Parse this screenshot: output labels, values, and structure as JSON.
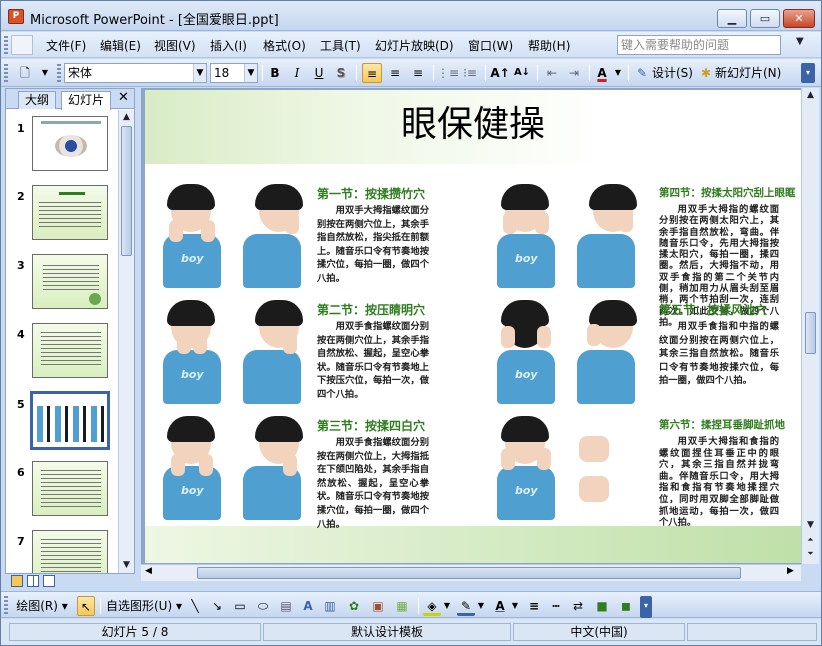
{
  "window": {
    "app_icon": "powerpoint-icon",
    "title": "Microsoft PowerPoint - [全国爱眼日.ppt]"
  },
  "menus": [
    "文件(F)",
    "编辑(E)",
    "视图(V)",
    "插入(I)",
    "格式(O)",
    "工具(T)",
    "幻灯片放映(D)",
    "窗口(W)",
    "帮助(H)"
  ],
  "help_placeholder": "键入需要帮助的问题",
  "formatting": {
    "font_name": "宋体",
    "font_size": "18",
    "bold": "B",
    "italic": "I",
    "underline": "U",
    "shadow": "S",
    "design_label": "设计(S)",
    "new_slide_label": "新幻灯片(N)"
  },
  "pane_tabs": {
    "outline": "大纲",
    "slides": "幻灯片"
  },
  "slide_thumbs": [
    {
      "num": "1",
      "kind": "eye"
    },
    {
      "num": "2",
      "kind": "green-text"
    },
    {
      "num": "3",
      "kind": "green-text"
    },
    {
      "num": "4",
      "kind": "green-text"
    },
    {
      "num": "5",
      "kind": "exercise",
      "selected": true
    },
    {
      "num": "6",
      "kind": "green-text"
    },
    {
      "num": "7",
      "kind": "green-text"
    }
  ],
  "slide": {
    "title": "眼保健操",
    "exercises": [
      {
        "title": "第一节：按揉攒竹穴",
        "desc": "用双手大拇指螺纹面分别按在两侧穴位上，其余手指自然放松，指尖抵在前额上。随音乐口令有节奏地按揉穴位，每拍一圈，做四个八拍。"
      },
      {
        "title": "第二节：按压睛明穴",
        "desc": "用双手食指螺纹面分别按在两侧穴位上，其余手指自然放松、握起，呈空心拳状。随音乐口令有节奏地上下按压穴位，每拍一次，做四个八拍。"
      },
      {
        "title": "第三节：按揉四白穴",
        "desc": "用双手食指螺纹面分别按在两侧穴位上，大拇指抵在下颌凹陷处，其余手指自然放松、握起，呈空心拳状。随音乐口令有节奏地按揉穴位，每拍一圈，做四个八拍。"
      },
      {
        "title": "第四节：按揉太阳穴刮上眼眶",
        "desc": "用双手大拇指的螺纹面分别按在两侧太阳穴上，其余手指自然放松，弯曲。伴随音乐口令，先用大拇指按揉太阳穴，每拍一圈，揉四圈。然后，大拇指不动，用双手食指的第二个关节内侧，稍加用力从眉头刮至眉梢，两个节拍刮一次，连刮两次。如此交替，做四个八拍。"
      },
      {
        "title": "第五节：按揉风池穴",
        "desc": "用双手食指和中指的螺纹面分别按在两侧穴位上，其余三指自然放松。随音乐口令有节奏地按揉穴位，每拍一圈，做四个八拍。"
      },
      {
        "title": "第六节：揉捏耳垂脚趾抓地",
        "desc": "用双手大拇指和食指的螺纹面捏住耳垂正中的眼穴，其余三指自然并拢弯曲。伴随音乐口令，用大拇指和食指有节奏地揉捏穴位，同时用双脚全部脚趾做抓地运动，每拍一次，做四个八拍。"
      }
    ]
  },
  "drawing": {
    "draw_label": "绘图(R)",
    "autoshapes_label": "自选图形(U)"
  },
  "status": {
    "slide_info": "幻灯片 5 / 8",
    "template": "默认设计模板",
    "language": "中文(中国)"
  }
}
